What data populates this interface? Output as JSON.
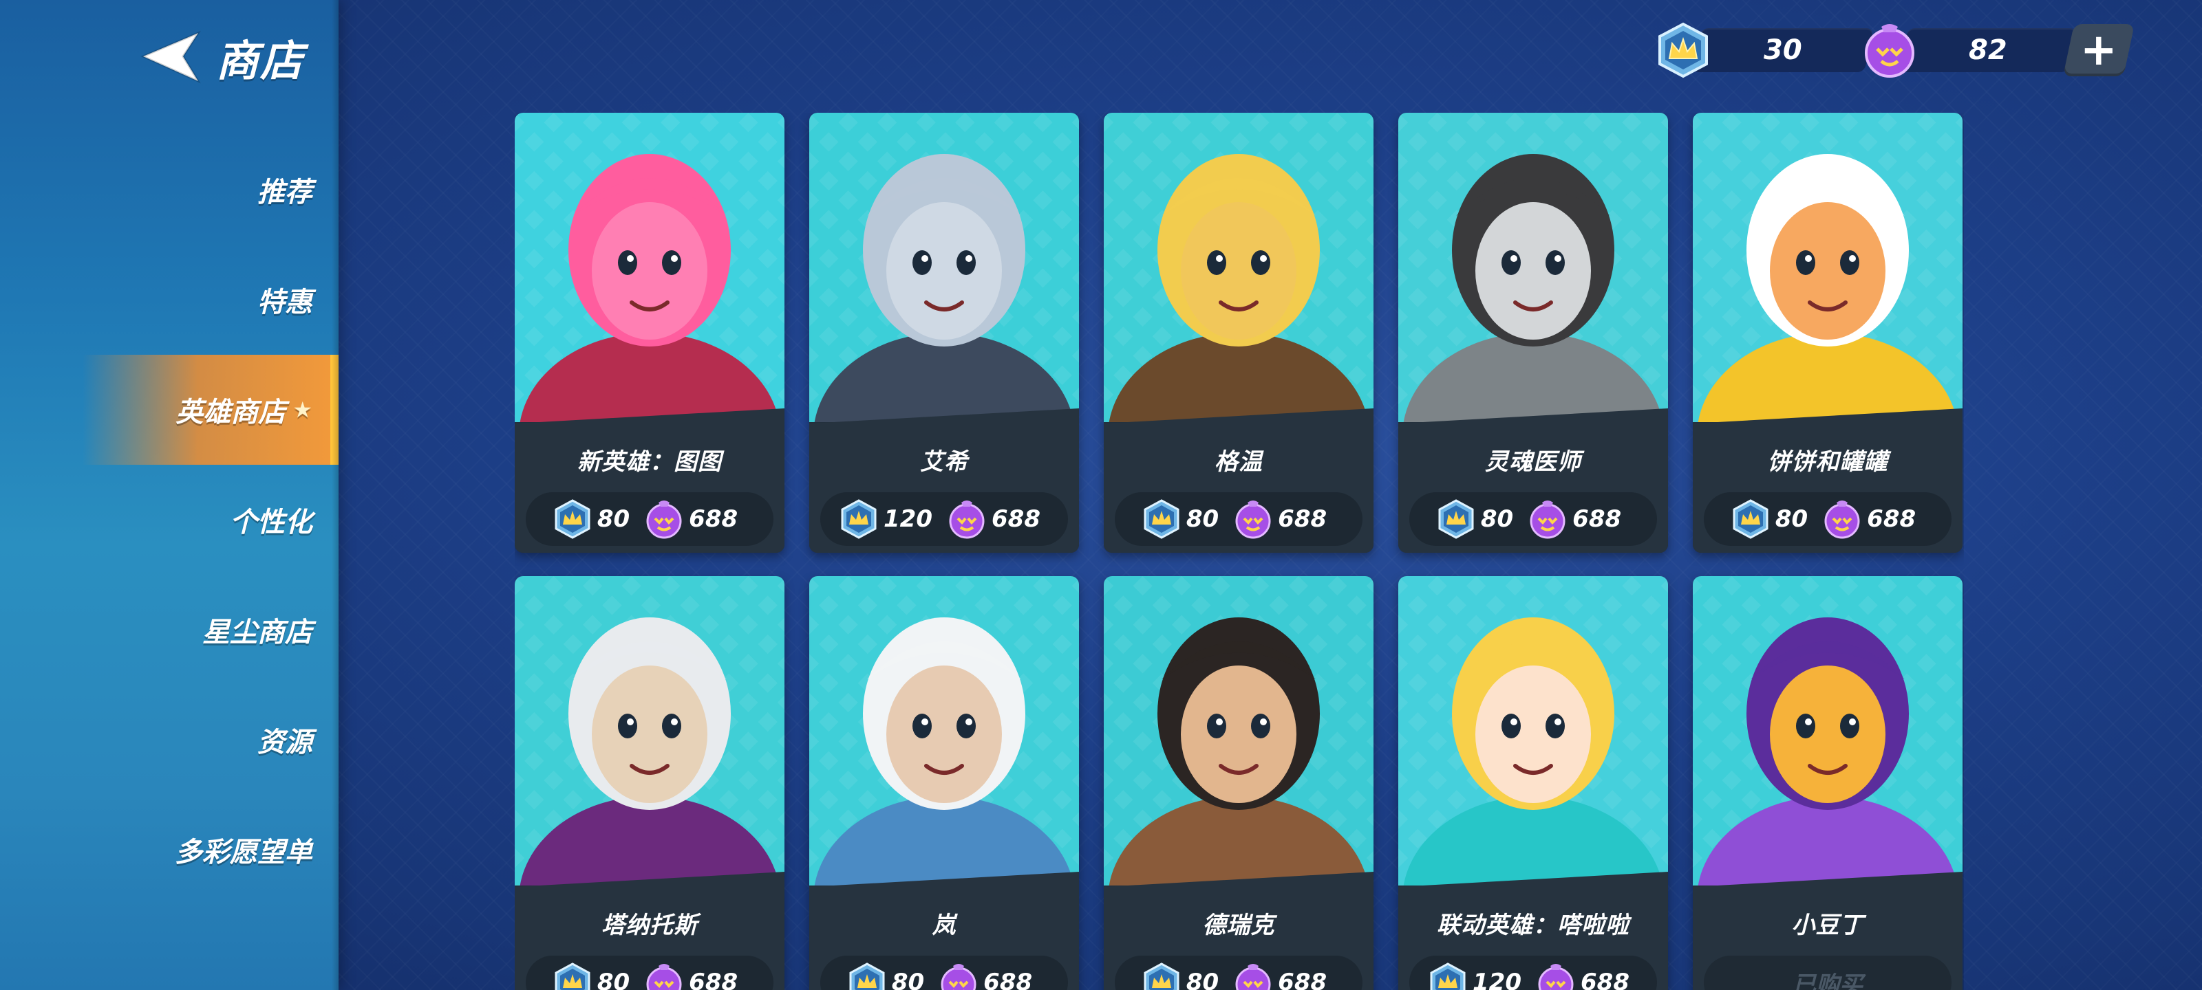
{
  "header": {
    "title": "商店",
    "currencies": [
      {
        "icon": "crown-token-icon",
        "value": "30"
      },
      {
        "icon": "purple-gem-icon",
        "value": "82"
      }
    ],
    "add_label": "+"
  },
  "sidebar": {
    "items": [
      {
        "label": "推荐",
        "active": false
      },
      {
        "label": "特惠",
        "active": false
      },
      {
        "label": "英雄商店",
        "active": true,
        "badge": "★"
      },
      {
        "label": "个性化",
        "active": false
      },
      {
        "label": "星尘商店",
        "active": false
      },
      {
        "label": "资源",
        "active": false
      },
      {
        "label": "多彩愿望单",
        "active": false
      }
    ]
  },
  "heroes": [
    {
      "name": "新英雄：图图",
      "token_price": "80",
      "gem_price": "688",
      "owned": false,
      "palette": {
        "bg": "#3fd2df",
        "main": "#ff7fb3",
        "hair": "#ff5d9e",
        "accent": "#b52d4f"
      }
    },
    {
      "name": "艾希",
      "token_price": "120",
      "gem_price": "688",
      "owned": false,
      "palette": {
        "bg": "#3ccfd8",
        "main": "#cfd9e4",
        "hair": "#b9c8d8",
        "accent": "#3d4a5e"
      }
    },
    {
      "name": "格温",
      "token_price": "80",
      "gem_price": "688",
      "owned": false,
      "palette": {
        "bg": "#3fcfd6",
        "main": "#f1c75a",
        "hair": "#f2cc4e",
        "accent": "#6b4a2c"
      }
    },
    {
      "name": "灵魂医师",
      "token_price": "80",
      "gem_price": "688",
      "owned": false,
      "palette": {
        "bg": "#45cfd8",
        "main": "#d3d6d8",
        "hair": "#3a3a3c",
        "accent": "#7d8488"
      }
    },
    {
      "name": "饼饼和罐罐",
      "token_price": "80",
      "gem_price": "688",
      "owned": false,
      "palette": {
        "bg": "#46d0dc",
        "main": "#f7a860",
        "hair": "#ffffff",
        "accent": "#f3c42a"
      }
    },
    {
      "name": "塔纳托斯",
      "token_price": "80",
      "gem_price": "688",
      "owned": false,
      "palette": {
        "bg": "#40cfd6",
        "main": "#e7d2b8",
        "hair": "#e8ebee",
        "accent": "#6b2a7d"
      }
    },
    {
      "name": "岚",
      "token_price": "80",
      "gem_price": "688",
      "owned": false,
      "palette": {
        "bg": "#3fcfd8",
        "main": "#e7cbb2",
        "hair": "#f1f4f6",
        "accent": "#4b8bc4"
      }
    },
    {
      "name": "德瑞克",
      "token_price": "80",
      "gem_price": "688",
      "owned": false,
      "palette": {
        "bg": "#3ccbd4",
        "main": "#e2b68e",
        "hair": "#2b2523",
        "accent": "#8a5b3a"
      }
    },
    {
      "name": "联动英雄：嗒啦啦",
      "token_price": "120",
      "gem_price": "688",
      "owned": false,
      "palette": {
        "bg": "#45d0dc",
        "main": "#fde2cc",
        "hair": "#f8d04a",
        "accent": "#27c6c8"
      }
    },
    {
      "name": "小豆丁",
      "token_price": "",
      "gem_price": "",
      "owned": true,
      "owned_label": "已购买",
      "palette": {
        "bg": "#3ecfd8",
        "main": "#f6b23a",
        "hair": "#5b2d9c",
        "accent": "#8f4fd6"
      }
    }
  ]
}
